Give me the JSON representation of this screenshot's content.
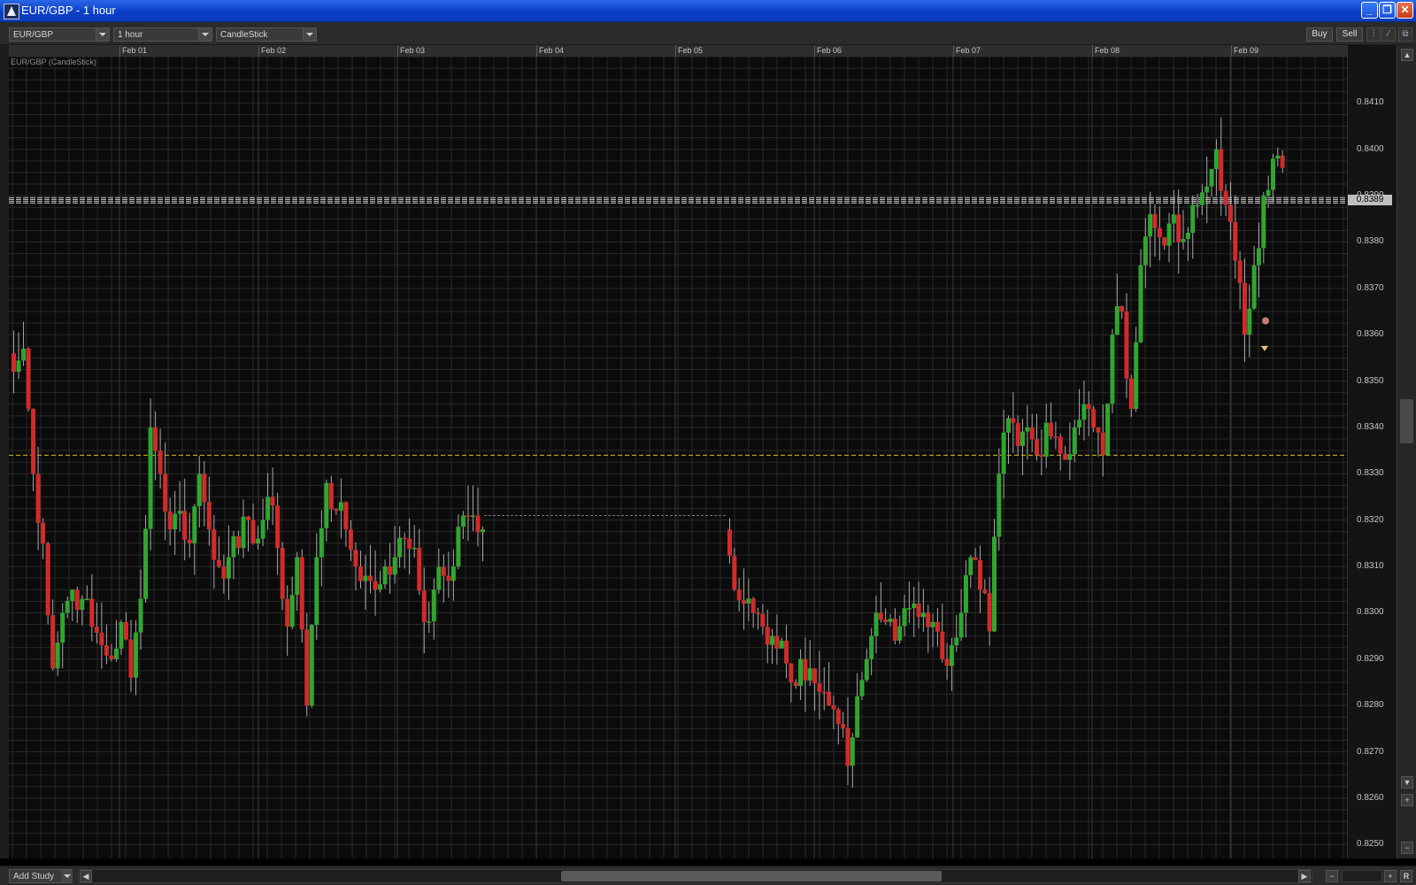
{
  "window": {
    "title": "EUR/GBP - 1 hour"
  },
  "toolbar": {
    "symbol": "EUR/GBP",
    "interval": "1 hour",
    "chart_type": "CandleStick",
    "buy_label": "Buy",
    "sell_label": "Sell"
  },
  "study_label": "EUR/GBP (CandleStick)",
  "current_price_label": "0.8389",
  "bottom": {
    "add_study_label": "Add Study",
    "reset_label": "R"
  },
  "colors": {
    "bull": "#2fa62f",
    "bear": "#d12b2b",
    "grid": "#2a2a2a",
    "reference_line": "#d8c000",
    "price_lines": "#c8c8c8"
  },
  "chart_data": {
    "type": "candlestick",
    "title": "EUR/GBP (CandleStick)",
    "x_labels": [
      "Feb 01",
      "Feb 02",
      "Feb 03",
      "Feb 04",
      "Feb 05",
      "Feb 06",
      "Feb 07",
      "Feb 08",
      "Feb 09"
    ],
    "y_ticks": [
      "0.8410",
      "0.8400",
      "0.8390",
      "0.8380",
      "0.8370",
      "0.8360",
      "0.8350",
      "0.8340",
      "0.8330",
      "0.8320",
      "0.8310",
      "0.8300",
      "0.8290",
      "0.8280",
      "0.8270",
      "0.8260",
      "0.8250"
    ],
    "ylim": [
      0.8247,
      0.842
    ],
    "reference_line": 0.8334,
    "current_price": 0.8389,
    "grid": true,
    "path": [
      0.8352,
      0.8357,
      0.833,
      0.8315,
      0.8288,
      0.83,
      0.8305,
      0.8303,
      0.8297,
      0.8293,
      0.829,
      0.8298,
      0.8286,
      0.8303,
      0.834,
      0.833,
      0.8318,
      0.8322,
      0.8315,
      0.833,
      0.8318,
      0.831,
      0.8312,
      0.8314,
      0.832,
      0.8316,
      0.8325,
      0.8314,
      0.8297,
      0.8312,
      0.828,
      0.8312,
      0.8328,
      0.8322,
      0.8318,
      0.831,
      0.8308,
      0.8305,
      0.831,
      0.8312,
      0.8316,
      0.8314,
      0.8298,
      0.8305,
      0.8308,
      0.831,
      0.8321,
      0.8321,
      0.8318,
      0.8305,
      0.8302,
      0.83,
      0.8297,
      0.8295,
      0.8294,
      0.8285,
      0.829,
      0.8288,
      0.8283,
      0.828,
      0.8276,
      0.8267,
      0.8282,
      0.829,
      0.83,
      0.8298,
      0.8294,
      0.8301,
      0.8302,
      0.83,
      0.8298,
      0.829,
      0.8293,
      0.83,
      0.8312,
      0.8305,
      0.8296,
      0.833,
      0.8342,
      0.8336,
      0.834,
      0.8334,
      0.8341,
      0.8338,
      0.8333,
      0.834,
      0.8345,
      0.834,
      0.8334,
      0.836,
      0.8365,
      0.8344,
      0.8375,
      0.8386,
      0.8381,
      0.8384,
      0.838,
      0.8382,
      0.8388,
      0.8392,
      0.84,
      0.8388,
      0.8376,
      0.836,
      0.8375,
      0.839,
      0.8398,
      0.8396
    ]
  }
}
